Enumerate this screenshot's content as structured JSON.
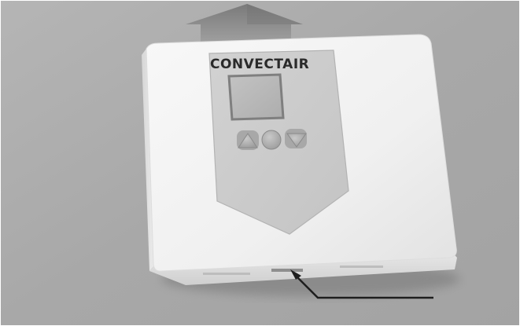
{
  "brand": {
    "logo_text": "CONVECTAIR"
  },
  "device": {
    "buttons": [
      {
        "name": "up",
        "icon": "triangle-up-icon"
      },
      {
        "name": "select",
        "icon": "circle-icon"
      },
      {
        "name": "down",
        "icon": "triangle-down-icon"
      }
    ]
  },
  "arrows": [
    {
      "name": "lift-up",
      "icon": "arrow-up-icon"
    },
    {
      "name": "pointer-to-bottom-slot",
      "icon": "arrow-pointer-icon"
    }
  ],
  "colors": {
    "background": "#a9a9a9",
    "housing": "#f2f2f2",
    "panel": "#cfcfcf",
    "screen": "#b9b9b9",
    "arrow": "#8e8e8e",
    "pointer": "#1e1e1e"
  }
}
